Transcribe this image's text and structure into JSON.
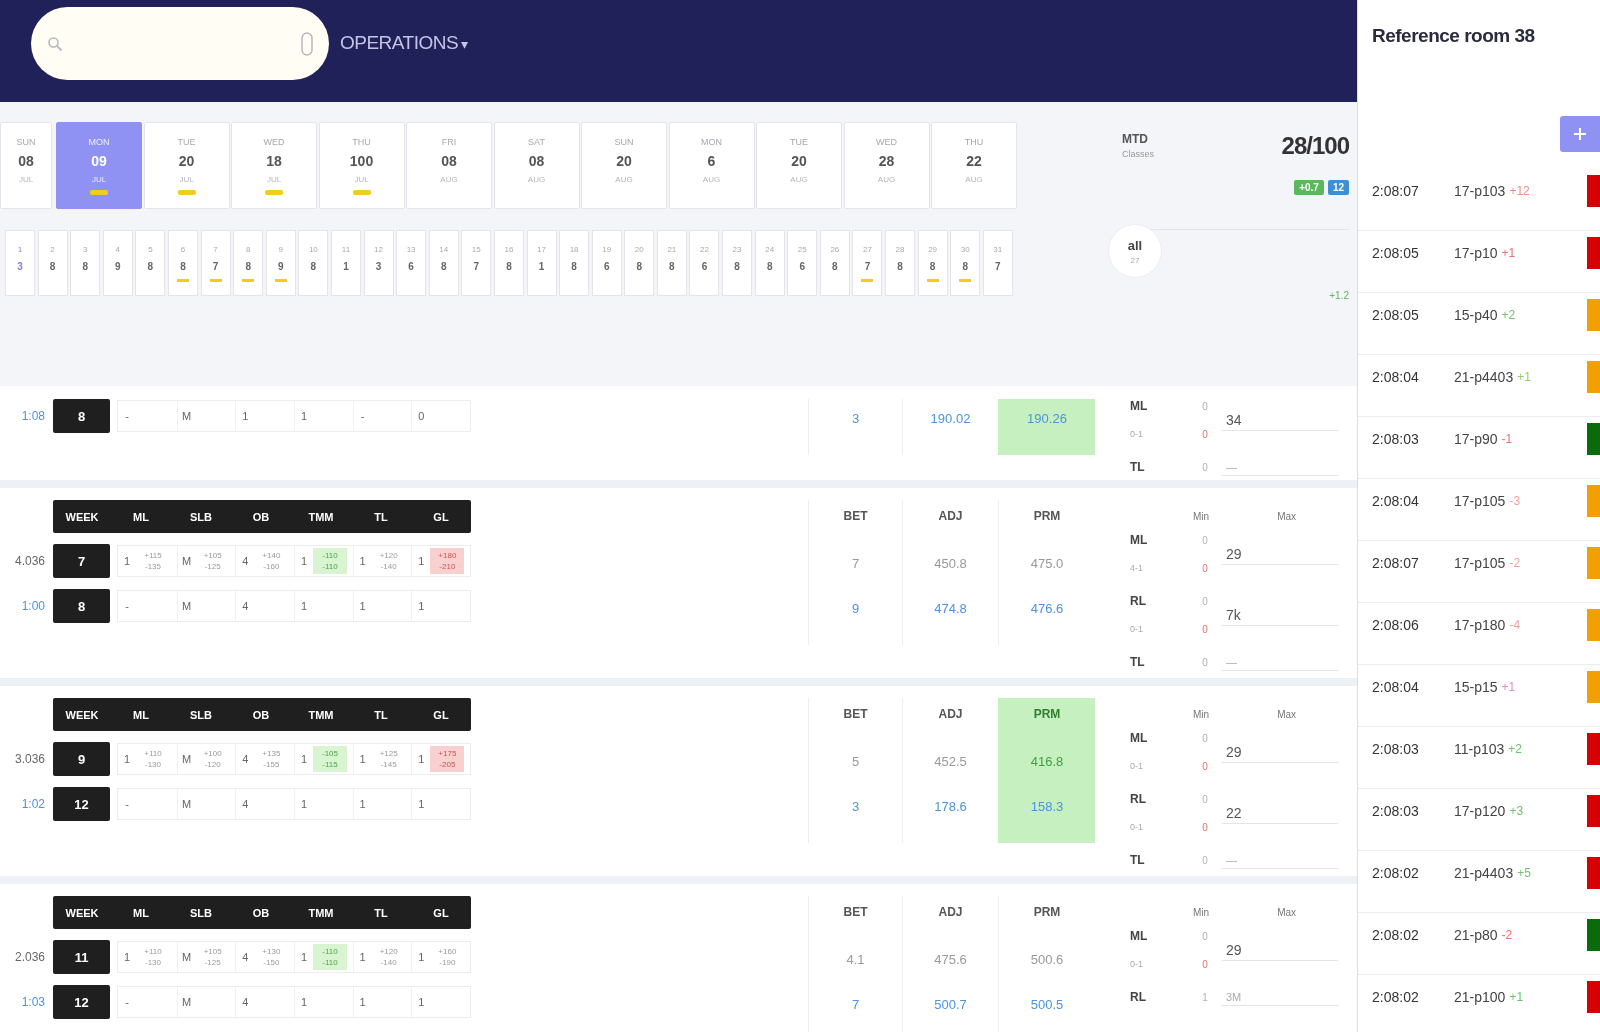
{
  "header": {
    "menu": {
      "label": "OPERATIONS",
      "caret": "▾"
    }
  },
  "calendar": {
    "days": [
      {
        "weekday": "SUN",
        "count": "08",
        "month": "JUL",
        "selected": false,
        "flagged": false
      },
      {
        "weekday": "MON",
        "count": "09",
        "month": "JUL",
        "selected": true,
        "flagged": true
      },
      {
        "weekday": "TUE",
        "count": "20",
        "month": "JUL",
        "selected": false,
        "flagged": true
      },
      {
        "weekday": "WED",
        "count": "18",
        "month": "JUL",
        "selected": false,
        "flagged": true
      },
      {
        "weekday": "THU",
        "count": "100",
        "month": "JUL",
        "selected": false,
        "flagged": true
      },
      {
        "weekday": "FRI",
        "count": "08",
        "month": "AUG",
        "selected": false,
        "flagged": false
      },
      {
        "weekday": "SAT",
        "count": "08",
        "month": "AUG",
        "selected": false,
        "flagged": false
      },
      {
        "weekday": "SUN",
        "count": "20",
        "month": "AUG",
        "selected": false,
        "flagged": false
      },
      {
        "weekday": "MON",
        "count": "6",
        "month": "AUG",
        "selected": false,
        "flagged": false
      },
      {
        "weekday": "TUE",
        "count": "20",
        "month": "AUG",
        "selected": false,
        "flagged": false
      },
      {
        "weekday": "WED",
        "count": "28",
        "month": "AUG",
        "selected": false,
        "flagged": false
      },
      {
        "weekday": "THU",
        "count": "22",
        "month": "AUG",
        "selected": false,
        "flagged": false
      }
    ],
    "slots": [
      {
        "label": "1",
        "value": "3",
        "selected": true,
        "flagged": false
      },
      {
        "label": "2",
        "value": "8",
        "selected": false,
        "flagged": false
      },
      {
        "label": "3",
        "value": "8",
        "selected": false,
        "flagged": false
      },
      {
        "label": "4",
        "value": "9",
        "selected": false,
        "flagged": false
      },
      {
        "label": "5",
        "value": "8",
        "selected": false,
        "flagged": false
      },
      {
        "label": "6",
        "value": "8",
        "selected": false,
        "flagged": true
      },
      {
        "label": "7",
        "value": "7",
        "selected": false,
        "flagged": true
      },
      {
        "label": "8",
        "value": "8",
        "selected": false,
        "flagged": true
      },
      {
        "label": "9",
        "value": "9",
        "selected": false,
        "flagged": true
      },
      {
        "label": "10",
        "value": "8",
        "selected": false,
        "flagged": false
      },
      {
        "label": "11",
        "value": "1",
        "selected": false,
        "flagged": false
      },
      {
        "label": "12",
        "value": "3",
        "selected": false,
        "flagged": false
      },
      {
        "label": "13",
        "value": "6",
        "selected": false,
        "flagged": false
      },
      {
        "label": "14",
        "value": "8",
        "selected": false,
        "flagged": false
      },
      {
        "label": "15",
        "value": "7",
        "selected": false,
        "flagged": false
      },
      {
        "label": "16",
        "value": "8",
        "selected": false,
        "flagged": false
      },
      {
        "label": "17",
        "value": "1",
        "selected": false,
        "flagged": false
      },
      {
        "label": "18",
        "value": "8",
        "selected": false,
        "flagged": false
      },
      {
        "label": "19",
        "value": "6",
        "selected": false,
        "flagged": false
      },
      {
        "label": "20",
        "value": "8",
        "selected": false,
        "flagged": false
      },
      {
        "label": "21",
        "value": "8",
        "selected": false,
        "flagged": false
      },
      {
        "label": "22",
        "value": "6",
        "selected": false,
        "flagged": false
      },
      {
        "label": "23",
        "value": "8",
        "selected": false,
        "flagged": false
      },
      {
        "label": "24",
        "value": "8",
        "selected": false,
        "flagged": false
      },
      {
        "label": "25",
        "value": "6",
        "selected": false,
        "flagged": false
      },
      {
        "label": "26",
        "value": "8",
        "selected": false,
        "flagged": false
      },
      {
        "label": "27",
        "value": "7",
        "selected": false,
        "flagged": true
      },
      {
        "label": "28",
        "value": "8",
        "selected": false,
        "flagged": false
      },
      {
        "label": "29",
        "value": "8",
        "selected": false,
        "flagged": true
      },
      {
        "label": "30",
        "value": "8",
        "selected": false,
        "flagged": true
      },
      {
        "label": "31",
        "value": "7",
        "selected": false,
        "flagged": false
      }
    ]
  },
  "stats": {
    "title": "MTD",
    "subtitle": "Classes",
    "total": "28/100",
    "chips": [
      {
        "text": "+0.7",
        "color": "#5cb85c"
      },
      {
        "text": "12",
        "color": "#3d8fd6"
      }
    ],
    "filter": {
      "label": "all",
      "count": "27"
    },
    "note": "+1.2"
  },
  "games": [
    {
      "teams": [
        {
          "label": "1:08",
          "link": true,
          "badge": "8",
          "cells": [
            {
              "value": "-"
            },
            {
              "value": "M"
            },
            {
              "value": "1"
            },
            {
              "value": "1"
            },
            {
              "value": "-"
            },
            {
              "value": "0"
            }
          ]
        }
      ],
      "summary": {
        "highlight": true,
        "rows": [
          {
            "kind": "live",
            "values": [
              "3",
              "190.02",
              "190.26"
            ]
          }
        ]
      },
      "markets": [
        {
          "label": "ML",
          "sub": "0-1",
          "min": "0",
          "limit": "0",
          "max": "34"
        },
        {
          "label": "TL",
          "min": "0",
          "max": "—"
        }
      ]
    },
    {
      "columns": [
        "WEEK",
        "ML",
        "SLB",
        "OB",
        "TMM",
        "TL",
        "GL"
      ],
      "teams": [
        {
          "label": "4.036",
          "link": false,
          "badge": "7",
          "cells": [
            {
              "value": "1",
              "odds": [
                "+115",
                "-135"
              ],
              "kind": "plain"
            },
            {
              "value": "M",
              "odds": [
                "+105",
                "-125"
              ],
              "kind": "plain"
            },
            {
              "value": "4",
              "odds": [
                "+140",
                "-160"
              ],
              "kind": "plain"
            },
            {
              "value": "1",
              "odds": [
                "-110",
                "-110"
              ],
              "kind": "up"
            },
            {
              "value": "1",
              "odds": [
                "+120",
                "-140"
              ],
              "kind": "plain"
            },
            {
              "value": "1",
              "odds": [
                "+180",
                "-210"
              ],
              "kind": "down"
            }
          ]
        },
        {
          "label": "1:00",
          "link": true,
          "badge": "8",
          "cells": [
            {
              "value": "-"
            },
            {
              "value": "M"
            },
            {
              "value": "4"
            },
            {
              "value": "1"
            },
            {
              "value": "1"
            },
            {
              "value": "1"
            }
          ]
        }
      ],
      "summary": {
        "columns": [
          "BET",
          "ADJ",
          "PRM"
        ],
        "highlight": false,
        "rows": [
          {
            "kind": "line",
            "values": [
              "7",
              "450.8",
              "475.0"
            ]
          },
          {
            "kind": "live",
            "values": [
              "9",
              "474.8",
              "476.6"
            ]
          }
        ]
      },
      "market_columns": [
        "Min",
        "Max"
      ],
      "markets": [
        {
          "label": "ML",
          "sub": "4-1",
          "min": "0",
          "limit": "0",
          "max": "29"
        },
        {
          "label": "RL",
          "sub": "0-1",
          "min": "0",
          "limit": "0",
          "max": "7k"
        },
        {
          "label": "TL",
          "min": "0",
          "max": "—"
        }
      ]
    },
    {
      "columns": [
        "WEEK",
        "ML",
        "SLB",
        "OB",
        "TMM",
        "TL",
        "GL"
      ],
      "teams": [
        {
          "label": "3.036",
          "link": false,
          "badge": "9",
          "cells": [
            {
              "value": "1",
              "odds": [
                "+110",
                "-130"
              ],
              "kind": "plain"
            },
            {
              "value": "M",
              "odds": [
                "+100",
                "-120"
              ],
              "kind": "plain"
            },
            {
              "value": "4",
              "odds": [
                "+135",
                "-155"
              ],
              "kind": "plain"
            },
            {
              "value": "1",
              "odds": [
                "-105",
                "-115"
              ],
              "kind": "up"
            },
            {
              "value": "1",
              "odds": [
                "+125",
                "-145"
              ],
              "kind": "plain"
            },
            {
              "value": "1",
              "odds": [
                "+175",
                "-205"
              ],
              "kind": "down"
            }
          ]
        },
        {
          "label": "1:02",
          "link": true,
          "badge": "12",
          "cells": [
            {
              "value": "-"
            },
            {
              "value": "M"
            },
            {
              "value": "4"
            },
            {
              "value": "1"
            },
            {
              "value": "1"
            },
            {
              "value": "1"
            }
          ]
        }
      ],
      "summary": {
        "columns": [
          "BET",
          "ADJ",
          "PRM"
        ],
        "highlight": true,
        "rows": [
          {
            "kind": "line",
            "values": [
              "5",
              "452.5",
              "416.8"
            ]
          },
          {
            "kind": "live",
            "values": [
              "3",
              "178.6",
              "158.3"
            ]
          }
        ]
      },
      "market_columns": [
        "Min",
        "Max"
      ],
      "markets": [
        {
          "label": "ML",
          "sub": "0-1",
          "min": "0",
          "limit": "0",
          "max": "29"
        },
        {
          "label": "RL",
          "sub": "0-1",
          "min": "0",
          "limit": "0",
          "max": "22"
        },
        {
          "label": "TL",
          "min": "0",
          "max": "—"
        }
      ]
    },
    {
      "columns": [
        "WEEK",
        "ML",
        "SLB",
        "OB",
        "TMM",
        "TL",
        "GL"
      ],
      "teams": [
        {
          "label": "2.036",
          "link": false,
          "badge": "11",
          "cells": [
            {
              "value": "1",
              "odds": [
                "+110",
                "-130"
              ],
              "kind": "plain"
            },
            {
              "value": "M",
              "odds": [
                "+105",
                "-125"
              ],
              "kind": "plain"
            },
            {
              "value": "4",
              "odds": [
                "+130",
                "-150"
              ],
              "kind": "plain"
            },
            {
              "value": "1",
              "odds": [
                "-110",
                "-110"
              ],
              "kind": "up"
            },
            {
              "value": "1",
              "odds": [
                "+120",
                "-140"
              ],
              "kind": "plain"
            },
            {
              "value": "1",
              "odds": [
                "+160",
                "-190"
              ],
              "kind": "plain"
            }
          ]
        },
        {
          "label": "1:03",
          "link": true,
          "badge": "12",
          "cells": [
            {
              "value": "-"
            },
            {
              "value": "M"
            },
            {
              "value": "4"
            },
            {
              "value": "1"
            },
            {
              "value": "1"
            },
            {
              "value": "1"
            }
          ]
        }
      ],
      "summary": {
        "columns": [
          "BET",
          "ADJ",
          "PRM"
        ],
        "highlight": false,
        "rows": [
          {
            "kind": "line",
            "values": [
              "4.1",
              "475.6",
              "500.6"
            ]
          },
          {
            "kind": "live",
            "values": [
              "7",
              "500.7",
              "500.5"
            ]
          }
        ]
      },
      "market_columns": [
        "Min",
        "Max"
      ],
      "markets": [
        {
          "label": "ML",
          "sub": "0-1",
          "min": "0",
          "limit": "0",
          "max": "29"
        },
        {
          "label": "RL",
          "min": "1",
          "max": "3M"
        }
      ]
    }
  ],
  "side_panel": {
    "title": "Reference room 38",
    "items": [
      {
        "time": "2:08:07",
        "code": "17-p103",
        "tag": {
          "text": "+12",
          "color": "#f08c8c"
        },
        "color": "#d60000"
      },
      {
        "time": "2:08:05",
        "code": "17-p10",
        "tag": {
          "text": "+1",
          "color": "#f07070"
        },
        "color": "#d60000"
      },
      {
        "time": "2:08:05",
        "code": "15-p40",
        "tag": {
          "text": "+2",
          "color": "#6cc46c"
        },
        "color": "#f0a000"
      },
      {
        "time": "2:08:04",
        "code": "21-p4403",
        "tag": {
          "text": "+1",
          "color": "#8fcf5f"
        },
        "color": "#f0a000"
      },
      {
        "time": "2:08:03",
        "code": "17-p90",
        "tag": {
          "text": "-1",
          "color": "#f07070"
        },
        "color": "#0b6b0b"
      },
      {
        "time": "2:08:04",
        "code": "17-p105",
        "tag": {
          "text": "-3",
          "color": "#f0a0a0"
        },
        "color": "#f0a000"
      },
      {
        "time": "2:08:07",
        "code": "17-p105",
        "tag": {
          "text": "-2",
          "color": "#f0a0a0"
        },
        "color": "#f0a000"
      },
      {
        "time": "2:08:06",
        "code": "17-p180",
        "tag": {
          "text": "-4",
          "color": "#f0a0a0"
        },
        "color": "#f0a000"
      },
      {
        "time": "2:08:04",
        "code": "15-p15",
        "tag": {
          "text": "+1",
          "color": "#f08cb4"
        },
        "color": "#f0a000"
      },
      {
        "time": "2:08:03",
        "code": "11-p103",
        "tag": {
          "text": "+2",
          "color": "#6cc46c"
        },
        "color": "#d60000"
      },
      {
        "time": "2:08:03",
        "code": "17-p120",
        "tag": {
          "text": "+3",
          "color": "#6cc46c"
        },
        "color": "#d60000"
      },
      {
        "time": "2:08:02",
        "code": "21-p4403",
        "tag": {
          "text": "+5",
          "color": "#6cc46c"
        },
        "color": "#d60000"
      },
      {
        "time": "2:08:02",
        "code": "21-p80",
        "tag": {
          "text": "-2",
          "color": "#f07070"
        },
        "color": "#0b6b0b"
      },
      {
        "time": "2:08:02",
        "code": "21-p100",
        "tag": {
          "text": "+1",
          "color": "#6cc46c"
        },
        "color": "#d60000"
      }
    ]
  }
}
